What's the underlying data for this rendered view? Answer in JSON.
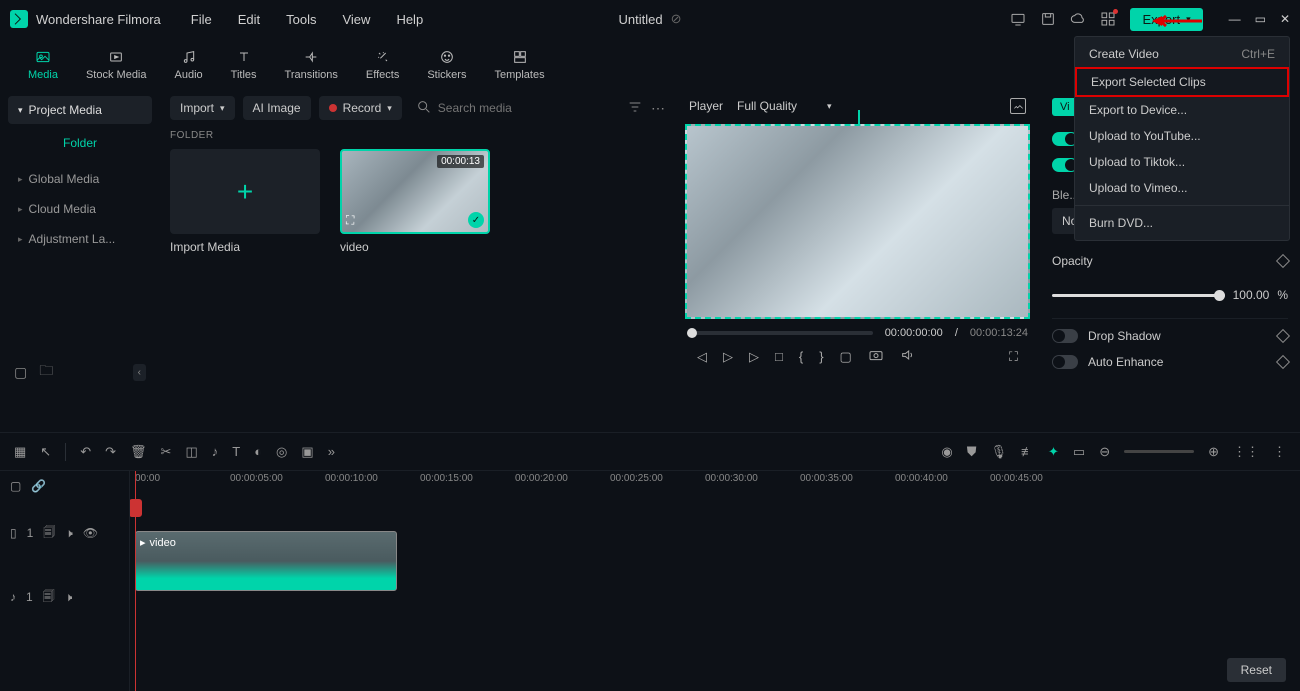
{
  "app_name": "Wondershare Filmora",
  "menu": {
    "file": "File",
    "edit": "Edit",
    "tools": "Tools",
    "view": "View",
    "help": "Help"
  },
  "document_title": "Untitled",
  "export_btn": "Export",
  "tool_tabs": {
    "media": "Media",
    "stock": "Stock Media",
    "audio": "Audio",
    "titles": "Titles",
    "transitions": "Transitions",
    "effects": "Effects",
    "stickers": "Stickers",
    "templates": "Templates"
  },
  "sidebar": {
    "project_media": "Project Media",
    "folder": "Folder",
    "global": "Global Media",
    "cloud": "Cloud Media",
    "adjustment": "Adjustment La..."
  },
  "media_toolbar": {
    "import": "Import",
    "ai_image": "AI Image",
    "record": "Record",
    "search_placeholder": "Search media"
  },
  "folder_label": "FOLDER",
  "media_items": {
    "import_label": "Import Media",
    "video_label": "video",
    "video_duration": "00:00:13"
  },
  "player": {
    "label": "Player",
    "quality": "Full Quality",
    "current": "00:00:00:00",
    "total": "00:00:13:24"
  },
  "props": {
    "blend": "Ble...",
    "blend_mode": "Normal",
    "opacity": "Opacity",
    "opacity_val": "100.00",
    "opacity_unit": "%",
    "drop_shadow": "Drop Shadow",
    "auto_enhance": "Auto Enhance",
    "reset": "Reset"
  },
  "export_menu": {
    "create_video": "Create Video",
    "create_shortcut": "Ctrl+E",
    "selected": "Export Selected Clips",
    "device": "Export to Device...",
    "youtube": "Upload to YouTube...",
    "tiktok": "Upload to Tiktok...",
    "vimeo": "Upload to Vimeo...",
    "dvd": "Burn DVD..."
  },
  "timeline": {
    "ticks": [
      "00:00",
      "00:00:05:00",
      "00:00:10:00",
      "00:00:15:00",
      "00:00:20:00",
      "00:00:25:00",
      "00:00:30:00",
      "00:00:35:00",
      "00:00:40:00",
      "00:00:45:00"
    ],
    "clip_label": "video",
    "video_track": "1",
    "audio_track": "1"
  }
}
